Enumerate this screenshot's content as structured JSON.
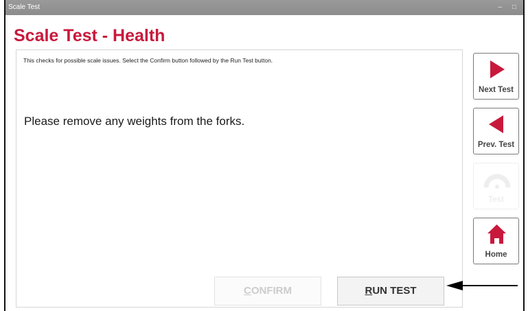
{
  "window": {
    "title": "Scale Test",
    "minimize_glyph": "–",
    "maximize_glyph": "□"
  },
  "page": {
    "heading": "Scale Test - Health",
    "instructions": "This checks for possible scale issues. Select the Confirm button followed by the Run Test button.",
    "message": "Please remove any weights from the forks."
  },
  "buttons": {
    "confirm": {
      "first": "C",
      "rest": "ONFIRM",
      "enabled": false
    },
    "run_test": {
      "first": "R",
      "rest": "UN TEST",
      "enabled": true
    }
  },
  "sidebar": {
    "next_test": {
      "label": "Next Test",
      "icon": "play-right-icon"
    },
    "prev_test": {
      "label": "Prev. Test",
      "icon": "play-left-icon"
    },
    "disabled_action": {
      "label": "Test",
      "icon": "gauge-icon",
      "enabled": false
    },
    "home": {
      "label": "Home",
      "icon": "home-icon"
    }
  },
  "colors": {
    "accent": "#c8193c",
    "titlebar": "#939393",
    "panel_border": "#d6d6d6"
  },
  "annotation": {
    "icon": "pointer-arrow-icon"
  }
}
